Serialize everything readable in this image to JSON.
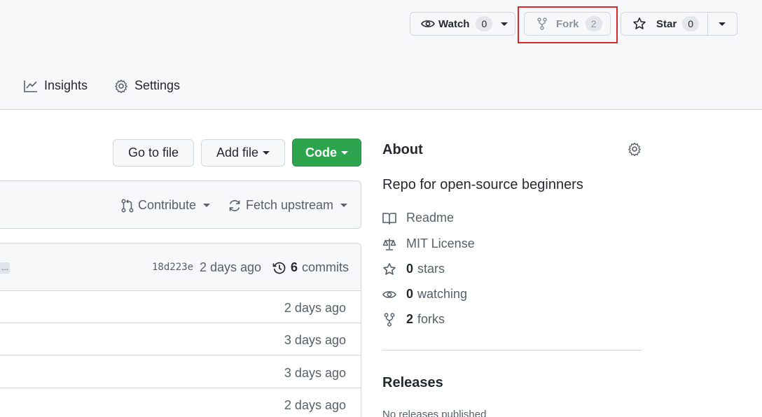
{
  "header": {
    "watch": {
      "label": "Watch",
      "count": "0"
    },
    "fork": {
      "label": "Fork",
      "count": "2"
    },
    "star": {
      "label": "Star",
      "count": "0"
    }
  },
  "tabs": [
    {
      "label": "Insights",
      "icon": "graph-icon"
    },
    {
      "label": "Settings",
      "icon": "gear-icon"
    }
  ],
  "toolbar": {
    "go_to_file": "Go to file",
    "add_file": "Add file",
    "code": "Code"
  },
  "fork_bar": {
    "contribute": "Contribute",
    "fetch_upstream": "Fetch upstream"
  },
  "commit_bar": {
    "truncated_label": "...",
    "sha": "18d223e",
    "time": "2 days ago",
    "commits_count": "6",
    "commits_label": "commits"
  },
  "files": [
    {
      "time": "2 days ago"
    },
    {
      "time": "3 days ago"
    },
    {
      "time": "3 days ago"
    },
    {
      "time": "2 days ago"
    }
  ],
  "about": {
    "heading": "About",
    "description": "Repo for open-source beginners",
    "readme": "Readme",
    "license": "MIT License",
    "stars_count": "0",
    "stars_label": "stars",
    "watching_count": "0",
    "watching_label": "watching",
    "forks_count": "2",
    "forks_label": "forks"
  },
  "releases": {
    "heading": "Releases",
    "empty": "No releases published"
  },
  "colors": {
    "code_button": "#2da44e",
    "highlight": "#d9262c",
    "header_bg": "#f6f8fa"
  }
}
